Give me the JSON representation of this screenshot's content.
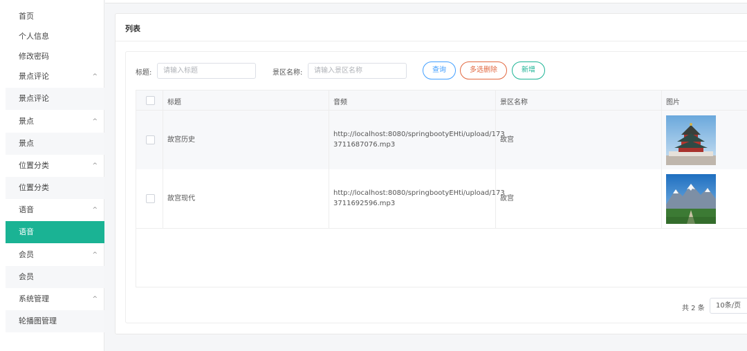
{
  "sidebar": {
    "items": [
      {
        "label": "首页"
      },
      {
        "label": "个人信息"
      },
      {
        "label": "修改密码"
      },
      {
        "label": "景点评论"
      },
      {
        "label": "景点评论"
      },
      {
        "label": "景点"
      },
      {
        "label": "景点"
      },
      {
        "label": "位置分类"
      },
      {
        "label": "位置分类"
      },
      {
        "label": "语音"
      },
      {
        "label": "语音"
      },
      {
        "label": "会员"
      },
      {
        "label": "会员"
      },
      {
        "label": "系统管理"
      },
      {
        "label": "轮播图管理"
      }
    ],
    "chevron": "^"
  },
  "card": {
    "title": "列表"
  },
  "search": {
    "title_label": "标题:",
    "title_placeholder": "请输入标题",
    "scenic_label": "景区名称:",
    "scenic_placeholder": "请输入景区名称"
  },
  "buttons": {
    "query": "查询",
    "multi_delete": "多选删除",
    "add": "新增"
  },
  "table": {
    "columns": [
      "标题",
      "音频",
      "景区名称",
      "图片"
    ],
    "rows": [
      {
        "title": "故宫历史",
        "audio_line1": "http://localhost:8080/springbootyEHti/upload/173",
        "audio_line2": "3711687076.mp3",
        "scenic": "故宫",
        "image_icon": "temple-photo"
      },
      {
        "title": "故宫现代",
        "audio_line1": "http://localhost:8080/springbootyEHti/upload/173",
        "audio_line2": "3711692596.mp3",
        "scenic": "故宫",
        "image_icon": "mountain-photo"
      }
    ]
  },
  "pagination": {
    "total": "共 2 条",
    "page_size": "10条/页"
  },
  "colors": {
    "accent": "#1ab394",
    "query": "#409eff",
    "delete": "#e2673f"
  }
}
